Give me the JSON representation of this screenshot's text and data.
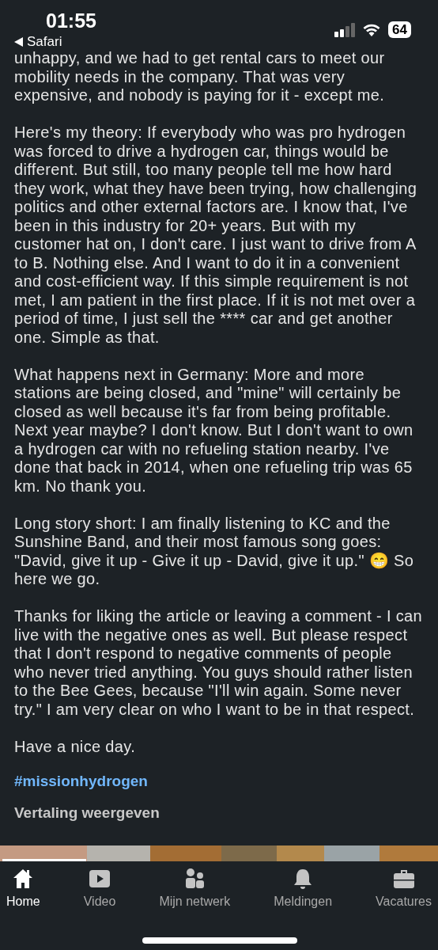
{
  "status_bar": {
    "time": "01:55",
    "back_label": "Safari",
    "battery": "64"
  },
  "post": {
    "paragraphs": [
      "unhappy, and we had to get rental cars to meet our mobility needs in the company. That was very expensive, and nobody is paying for it - except me.",
      "Here's my theory: If everybody who was pro hydrogen was forced to drive a hydrogen car, things would be different. But still, too many people tell me how hard they work, what they have been trying, how challenging politics and other external factors are. I know that, I've been in this industry for 20+ years. But with my customer hat on, I don't care. I just want to drive from A to B. Nothing else. And I want to do it in a convenient and cost-efficient way. If this simple requirement is not met, I am patient in the first place. If it is not met over a period of time, I just sell the **** car and get another one. Simple as that.",
      "What happens next in Germany: More and more stations are being closed, and \"mine\" will certainly be closed as well because it's far from being profitable. Next year maybe? I don't know. But I don't want to own a hydrogen car with no refueling station nearby. I've done that back in 2014, when one refueling trip was 65 km. No thank you.",
      "Long story short: I am finally listening to KC and the Sunshine Band, and their most famous song goes: \"David, give it up - Give it up - David, give it up.\" 😁 So here we go.",
      "Thanks for liking the article or leaving a comment - I can live with the negative ones as well. But please respect that I don't respond to negative comments of people who never tried anything. You guys should rather listen to the Bee Gees, because \"I'll win again. Some never try.\" I am very clear on who I want to be in that respect.",
      "Have a nice day."
    ],
    "hashtag": "#missionhydrogen",
    "translate": "Vertaling weergeven"
  },
  "tab_bar": [
    {
      "label": "Home",
      "kind": "home",
      "selected": true
    },
    {
      "label": "Video",
      "kind": "video",
      "selected": false
    },
    {
      "label": "Mijn netwerk",
      "kind": "network",
      "selected": false
    },
    {
      "label": "Meldingen",
      "kind": "bell",
      "selected": false
    },
    {
      "label": "Vacatures",
      "kind": "briefcase",
      "selected": false
    }
  ]
}
